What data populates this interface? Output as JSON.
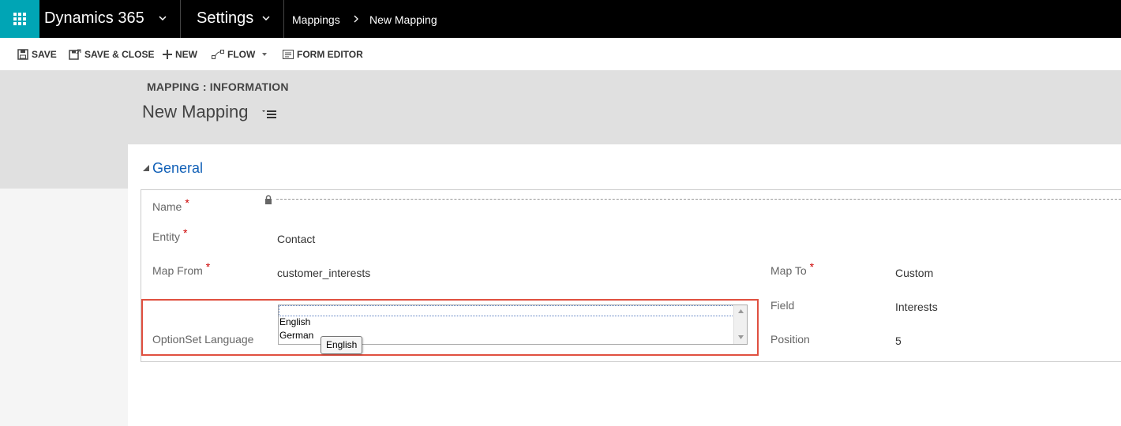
{
  "nav": {
    "app_name": "Dynamics 365",
    "area": "Settings",
    "breadcrumb": [
      "Mappings",
      "New Mapping"
    ]
  },
  "toolbar": {
    "save": "SAVE",
    "save_close": "SAVE & CLOSE",
    "new": "NEW",
    "flow": "FLOW",
    "form_editor": "FORM EDITOR"
  },
  "header": {
    "form_type": "MAPPING : INFORMATION",
    "title": "New Mapping"
  },
  "section": {
    "title": "General"
  },
  "fields": {
    "name": {
      "label": "Name",
      "required": "*",
      "value": ""
    },
    "entity": {
      "label": "Entity",
      "required": "*",
      "value": "Contact"
    },
    "map_from": {
      "label": "Map From",
      "required": "*",
      "value": "customer_interests"
    },
    "optionset_language": {
      "label": "OptionSet Language",
      "options": [
        "",
        "English",
        "German"
      ],
      "tooltip": "English"
    },
    "map_to": {
      "label": "Map To",
      "required": "*",
      "value": "Custom"
    },
    "field": {
      "label": "Field",
      "value": "Interests"
    },
    "position": {
      "label": "Position",
      "value": "5"
    }
  },
  "colors": {
    "topbar": "#000000",
    "waffle": "#00a5b5",
    "section_title": "#1160b7",
    "required": "#cc0000",
    "highlight": "#e05040"
  },
  "icons": [
    "waffle-icon",
    "chevron-down-icon",
    "chevron-right-icon",
    "save-icon",
    "save-close-icon",
    "plus-icon",
    "flow-icon",
    "form-editor-icon",
    "menu-icon",
    "collapse-arrow-icon",
    "lock-icon"
  ]
}
